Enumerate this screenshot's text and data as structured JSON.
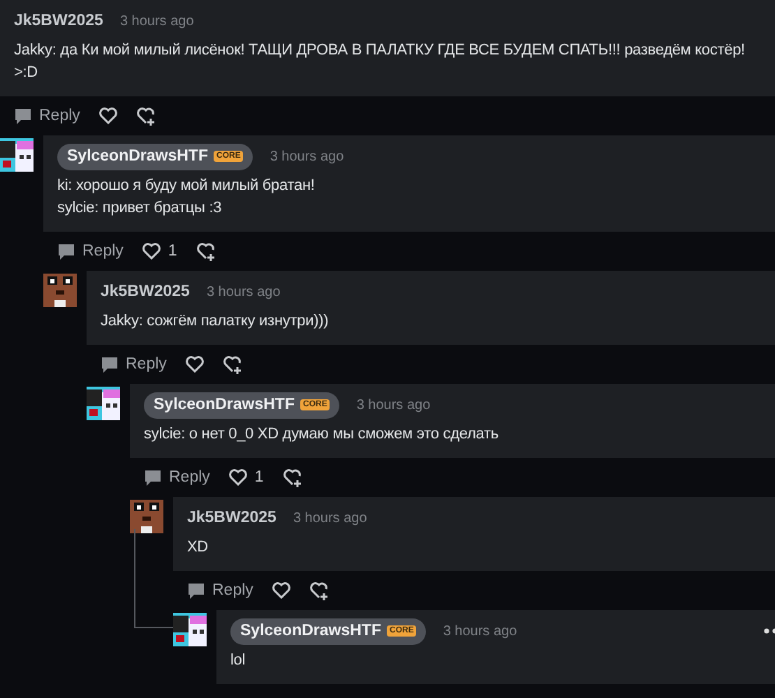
{
  "comments": [
    {
      "user": "Jk5BW2025",
      "highlighted": false,
      "time": "3 hours ago",
      "lines": [
        "Jakky: да Ки мой милый лисёнок! ТАЩИ ДРОВА В ПАЛАТКУ ГДЕ ВСЕ БУДЕМ СПАТЬ!!! разведём костёр!",
        ">:D"
      ],
      "reply": "Reply",
      "children": [
        {
          "user": "SylceonDrawsHTF",
          "badge": "CORE",
          "highlighted": true,
          "time": "3 hours ago",
          "kind": "pastel",
          "lines": [
            "ki: хорошо я буду мой милый братан!",
            "sylcie: привет братцы :3"
          ],
          "reply": "Reply",
          "likes": "1",
          "children": [
            {
              "user": "Jk5BW2025",
              "highlighted": false,
              "time": "3 hours ago",
              "kind": "brown",
              "lines": [
                "Jakky: сожгём палатку изнутри)))"
              ],
              "reply": "Reply",
              "children": [
                {
                  "user": "SylceonDrawsHTF",
                  "badge": "CORE",
                  "highlighted": true,
                  "time": "3 hours ago",
                  "kind": "pastel",
                  "lines": [
                    "sylcie: о нет 0_0 XD думаю мы сможем это сделать"
                  ],
                  "reply": "Reply",
                  "likes": "1",
                  "children": [
                    {
                      "user": "Jk5BW2025",
                      "highlighted": false,
                      "time": "3 hours ago",
                      "kind": "brown",
                      "lines": [
                        "XD"
                      ],
                      "reply": "Reply",
                      "children": [
                        {
                          "user": "SylceonDrawsHTF",
                          "badge": "CORE",
                          "highlighted": true,
                          "time": "3 hours ago",
                          "kind": "pastel",
                          "thread_line": true,
                          "menu": true,
                          "lines": [
                            "lol"
                          ]
                        }
                      ]
                    }
                  ]
                }
              ]
            }
          ]
        }
      ]
    }
  ]
}
